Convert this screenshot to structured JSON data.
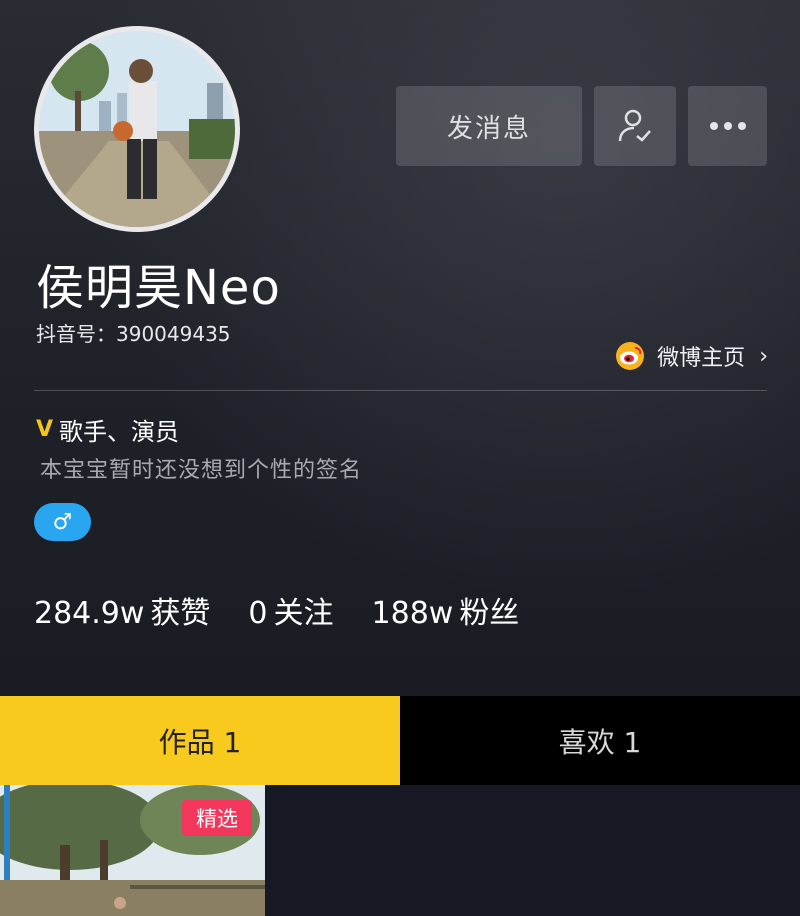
{
  "header": {
    "buttons": {
      "message_label": "发消息",
      "follow_icon": "user-check-icon",
      "more_icon": "more-dots-icon"
    }
  },
  "profile": {
    "name": "侯明昊Neo",
    "douyin_id": "抖音号：390049435",
    "weibo_label": "微博主页",
    "verified_mark": "V",
    "verified_text": "歌手、演员",
    "signature": "本宝宝暂时还没想到个性的签名",
    "gender_symbol": "♂"
  },
  "stats": {
    "likes_value": "284.9w",
    "likes_label": "获赞",
    "following_value": "0",
    "following_label": "关注",
    "fans_value": "188w",
    "fans_label": "粉丝"
  },
  "tabs": [
    {
      "label": "作品 1",
      "active": true
    },
    {
      "label": "喜欢 1",
      "active": false
    }
  ],
  "videos": [
    {
      "badge": "精选"
    }
  ],
  "colors": {
    "accent": "#f8ca1d",
    "badge": "#f2365c",
    "gender": "#2aa6f0",
    "background": "#161823"
  }
}
